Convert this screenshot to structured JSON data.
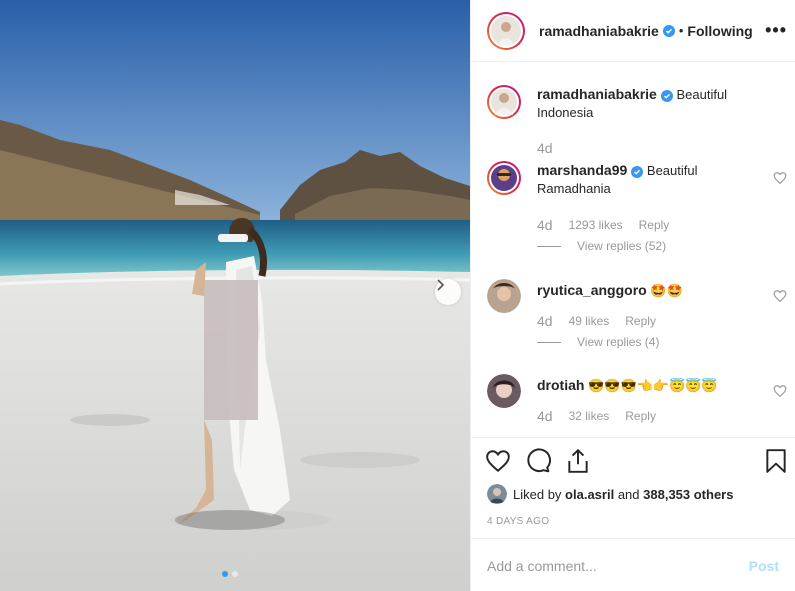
{
  "post": {
    "author": "ramadhaniabakrie",
    "follow_separator": "•",
    "follow_status": "Following",
    "more_label": "•••"
  },
  "caption": {
    "username": "ramadhaniabakrie",
    "text_line1": "Beautiful",
    "text_line2": "Indonesia",
    "age": "4d"
  },
  "comments": [
    {
      "username": "marshanda99",
      "verified": true,
      "text_line1": "Beautiful",
      "text_line2": "Ramadhania",
      "age": "4d",
      "likes": "1293 likes",
      "reply": "Reply",
      "view_replies": "View replies (52)"
    },
    {
      "username": "ryutica_anggoro",
      "verified": false,
      "text": "🤩🤩",
      "age": "4d",
      "likes": "49 likes",
      "reply": "Reply",
      "view_replies": "View replies (4)"
    },
    {
      "username": "drotiah",
      "verified": false,
      "text": "😎😎😎👈👉😇😇😇",
      "age": "4d",
      "likes": "32 likes",
      "reply": "Reply"
    }
  ],
  "likes_line": {
    "prefix": "Liked by",
    "user": "ola.asril",
    "and": "and",
    "count": "388,353 others"
  },
  "date": "4 DAYS AGO",
  "add_comment": {
    "placeholder": "Add a comment...",
    "post_label": "Post"
  },
  "carousel": {
    "current": 1,
    "total": 2
  },
  "colors": {
    "accent": "#3897f0",
    "post_disabled": "#b2dffc",
    "muted": "#999999"
  },
  "icons": [
    "heart-icon",
    "comment-icon",
    "share-icon",
    "bookmark-icon",
    "chevron-right-icon",
    "verified-badge-icon"
  ]
}
